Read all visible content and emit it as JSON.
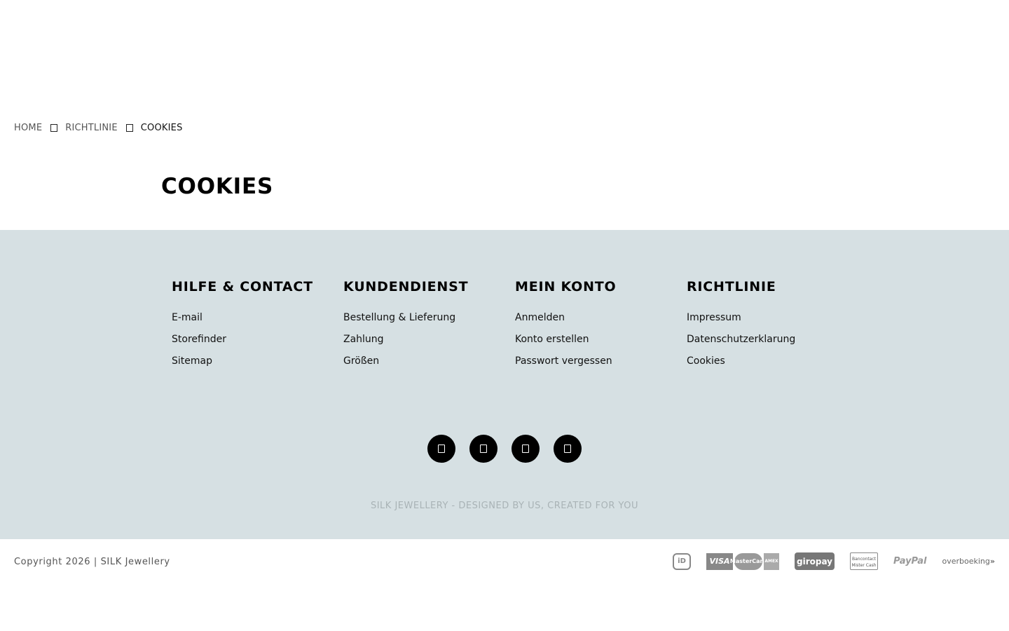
{
  "breadcrumb": {
    "items": [
      {
        "label": "HOME"
      },
      {
        "label": "RICHTLINIE"
      }
    ],
    "current": "COOKIES"
  },
  "page": {
    "title": "COOKIES"
  },
  "footer": {
    "columns": [
      {
        "heading": "HILFE & CONTACT",
        "links": [
          "E-mail",
          "Storefinder",
          "Sitemap"
        ]
      },
      {
        "heading": "KUNDENDIENST",
        "links": [
          "Bestellung & Lieferung",
          "Zahlung",
          "Größen"
        ]
      },
      {
        "heading": "MEIN KONTO",
        "links": [
          "Anmelden",
          "Konto erstellen",
          "Passwort vergessen"
        ]
      },
      {
        "heading": "RICHTLINIE",
        "links": [
          "Impressum",
          "Datenschutzerklarung",
          "Cookies"
        ]
      }
    ],
    "socials": [
      {
        "icon": "social-icon-1"
      },
      {
        "icon": "social-icon-2"
      },
      {
        "icon": "social-icon-3"
      },
      {
        "icon": "social-icon-4"
      }
    ],
    "tagline": "SILK JEWELLERY - DESIGNED BY US, CREATED FOR YOU",
    "background_color": "#d6e0e3"
  },
  "bottom": {
    "copyright": "Copyright 2026 | SILK Jewellery",
    "payments": {
      "ideal": "iD",
      "visa": "VISA",
      "mastercard": "MasterCard",
      "amex": "AMEX",
      "giropay": "giropay",
      "bancontact": "Bancontact Mister Cash",
      "paypal": "PayPal",
      "overboeking_over": "over",
      "overboeking_boeking": "boeking",
      "overboeking_arrow": "»"
    }
  }
}
